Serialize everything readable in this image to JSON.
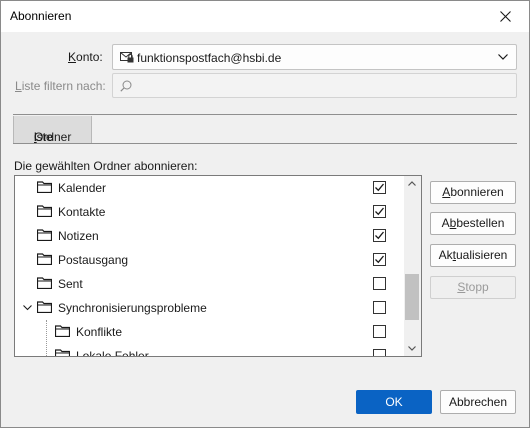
{
  "window": {
    "title": "Abonnieren"
  },
  "account": {
    "label_prefix": "K",
    "label_rest": "onto:",
    "value": "funktionspostfach@hsbi.de"
  },
  "filter": {
    "label_prefix": "L",
    "label_rest": "iste filtern nach:",
    "value": ""
  },
  "tabs": [
    {
      "label_pre": "Ordner",
      "label_u": "l",
      "label_post": "iste"
    }
  ],
  "tree": {
    "heading": "Die gewählten Ordner abonnieren:",
    "items": [
      {
        "name": "Kalender",
        "checked": true
      },
      {
        "name": "Kontakte",
        "checked": true
      },
      {
        "name": "Notizen",
        "checked": true
      },
      {
        "name": "Postausgang",
        "checked": true
      },
      {
        "name": "Sent",
        "checked": false
      },
      {
        "name": "Synchronisierungsprobleme",
        "checked": false,
        "expanded": true
      },
      {
        "name": "Konflikte",
        "checked": false
      },
      {
        "name": "Lokale Fehler",
        "checked": false
      }
    ]
  },
  "side_buttons": {
    "subscribe_u": "A",
    "subscribe_rest": "bonnieren",
    "unsubscribe_pre": "A",
    "unsubscribe_u": "b",
    "unsubscribe_post": "bestellen",
    "refresh_pre": "Ak",
    "refresh_u": "t",
    "refresh_post": "ualisieren",
    "stop_pre": "",
    "stop_u": "S",
    "stop_post": "topp"
  },
  "footer": {
    "ok": "OK",
    "cancel": "Abbrechen"
  },
  "colors": {
    "accent": "#0a63c4",
    "tab_bg": "#dcdcdc"
  }
}
